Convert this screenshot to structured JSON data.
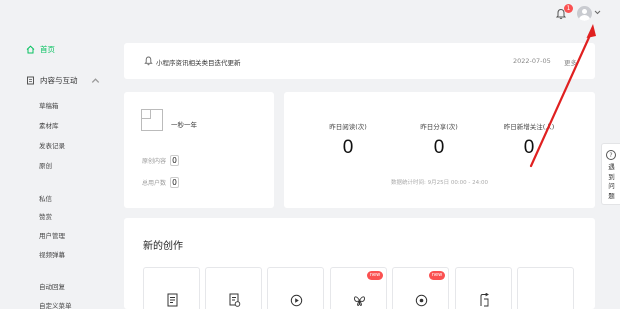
{
  "header": {
    "notification_count": "1",
    "bell_icon": "bell-icon",
    "avatar_icon": "user-avatar-icon",
    "caret_icon": "chevron-down-icon"
  },
  "sidebar": {
    "home": "首页",
    "content_group": "内容与互动",
    "content_items": [
      "草稿箱",
      "素材库",
      "发表记录",
      "原创"
    ],
    "interaction_items": [
      "私信",
      "赞赏",
      "用户管理",
      "视频弹幕"
    ],
    "auto_items": [
      "自动回复",
      "自定义菜单"
    ]
  },
  "notice": {
    "text": "小程序资讯相关类目迭代更新",
    "date": "2022-07-05",
    "more": "更多"
  },
  "account": {
    "name": "一秒一年",
    "original_label": "原创内容",
    "original_value": "0",
    "users_label": "总用户数",
    "users_value": "0"
  },
  "stats": {
    "metrics": [
      {
        "label": "昨日阅读(次)",
        "value": "0"
      },
      {
        "label": "昨日分享(次)",
        "value": "0"
      },
      {
        "label": "昨日新增关注(人)",
        "value": "0"
      }
    ],
    "note": "数据统计时间: 9月25日 00:00 - 24:00"
  },
  "create": {
    "title": "新的创作",
    "tiles": [
      {
        "icon": "article-icon",
        "badge": ""
      },
      {
        "icon": "repost-icon",
        "badge": ""
      },
      {
        "icon": "video-icon",
        "badge": ""
      },
      {
        "icon": "butterfly-icon",
        "badge": "new"
      },
      {
        "icon": "audio-icon",
        "badge": "new"
      },
      {
        "icon": "share-icon",
        "badge": ""
      },
      {
        "icon": "more-icon",
        "badge": ""
      }
    ]
  },
  "sidetab": {
    "label": "遇到问题",
    "icon": "help-icon"
  },
  "colors": {
    "accent": "#07c160",
    "badge": "#fa5151",
    "annotation_arrow": "#e02020"
  }
}
